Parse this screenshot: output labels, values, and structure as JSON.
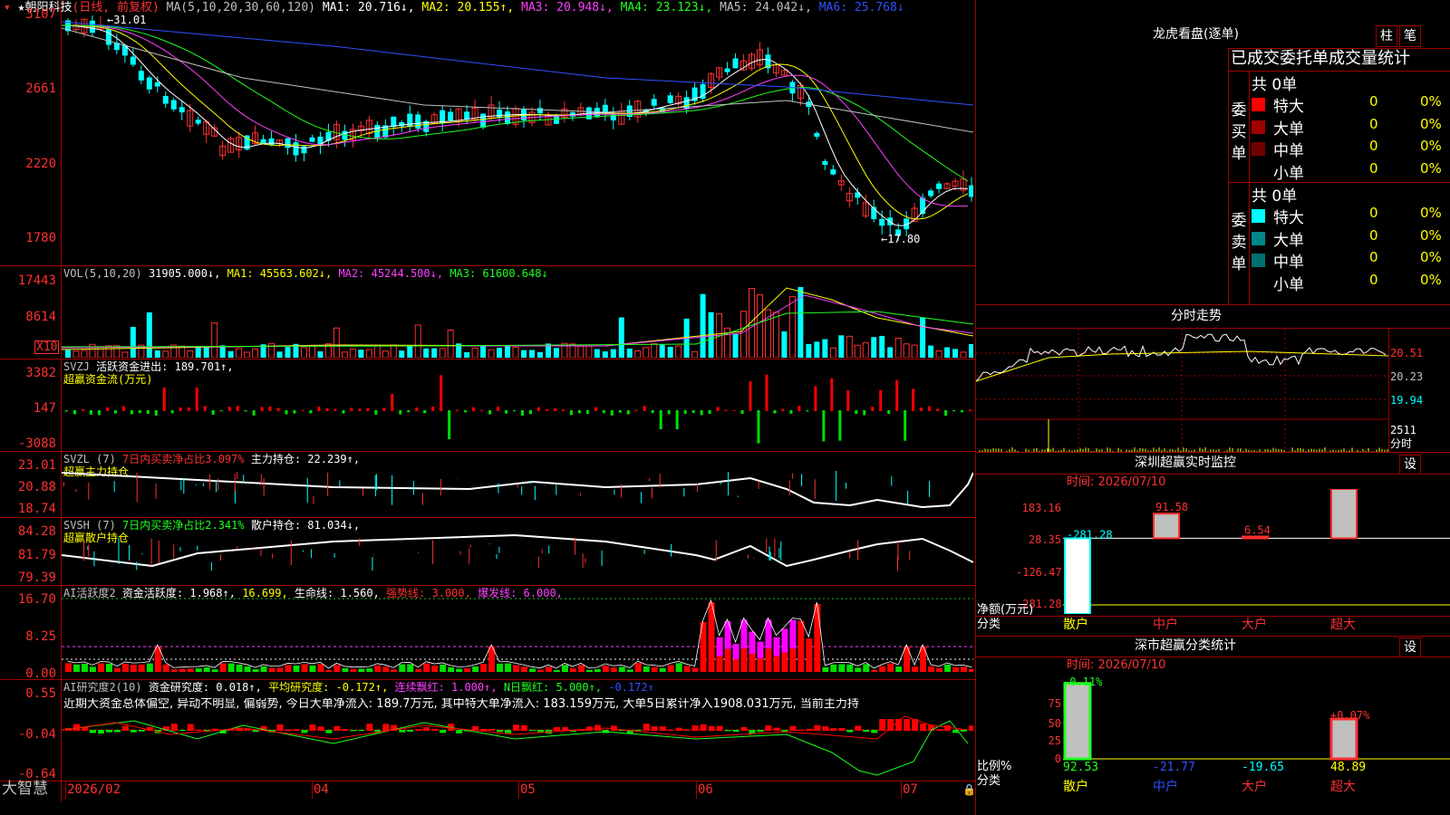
{
  "stock": {
    "name": "朝阳科技",
    "period": "(日线, 前复权)",
    "ma_label": "MA(5,10,20,30,60,120)",
    "ma1": "MA1: 20.716↓,",
    "ma2": "MA2: 20.155↑,",
    "ma3": "MA3: 20.948↓,",
    "ma4": "MA4: 23.123↓,",
    "ma5": "MA5: 24.042↓,",
    "ma6": "MA6: 25.768↓",
    "high_mark": "31.01",
    "low_mark": "17.80",
    "y_ticks": [
      "3107",
      "2661",
      "2220",
      "1780"
    ]
  },
  "vol": {
    "title": "VOL(5,10,20)",
    "value": "31905.000↓,",
    "ma1": "MA1: 45563.602↓,",
    "ma2": "MA2: 45244.500↓,",
    "ma3": "MA3: 61600.648↓",
    "y_ticks": [
      "17443",
      "8614"
    ],
    "unit": "X10"
  },
  "svzj": {
    "title": "SVZJ",
    "line": "活跃资金进出: 189.701↑,",
    "subtitle": "超赢资金流(万元)",
    "y_ticks": [
      "3382",
      "147",
      "-3088"
    ]
  },
  "svzl": {
    "title": "SVZL (7)",
    "ratio": "7日内买卖净占比3.097%",
    "hold": "主力持仓: 22.239↑,",
    "subtitle": "超赢主力持仓",
    "y_ticks": [
      "23.01",
      "20.88",
      "18.74"
    ]
  },
  "svsh": {
    "title": "SVSH (7)",
    "ratio": "7日内买卖净占比2.341%",
    "hold": "散户持仓: 81.034↓,",
    "subtitle": "超赢散户持仓",
    "y_ticks": [
      "84.28",
      "81.79",
      "79.39"
    ]
  },
  "ai1": {
    "title": "AI活跃度2",
    "a": "资金活跃度: 1.968↑,",
    "b": "16.699,",
    "c": "生命线: 1.560,",
    "d": "强势线: 3.000,",
    "e": "爆发线: 6.000,",
    "y_ticks": [
      "16.70",
      "8.25",
      "0.00"
    ]
  },
  "ai2": {
    "title": "AI研究度2(10)",
    "a": "资金研究度: 0.018↑,",
    "b": "平均研究度: -0.172↑,",
    "c": "连续飘红: 1.000↑,",
    "d": "N日飘红: 5.000↑,",
    "e": "-0.172↑",
    "summary": "近期大资金总体偏空, 异动不明显, 偏弱势, 今日大单净流入: 189.7万元, 其中特大单净流入: 183.159万元, 大单5日累计净入1908.031万元, 当前主力持",
    "y_ticks": [
      "0.55",
      "-0.04",
      "-0.64"
    ]
  },
  "bottom": {
    "brand": "大智慧",
    "dates": [
      "2026/02",
      "04",
      "05",
      "06",
      "07"
    ]
  },
  "right": {
    "dragon_title": "龙虎看盘(逐单)",
    "btn_zhu": "柱",
    "btn_bi": "笔",
    "stat_title": "已成交委托单成交量统计",
    "buy_label": "委买单",
    "sell_label": "委卖单",
    "buy_total": "共 0单",
    "sell_total": "共 0单",
    "buy_rows": [
      {
        "name": "特大",
        "n": "0",
        "p": "0%",
        "color": "#ff0000"
      },
      {
        "name": "大单",
        "n": "0",
        "p": "0%",
        "color": "#a00000"
      },
      {
        "name": "中单",
        "n": "0",
        "p": "0%",
        "color": "#700000"
      },
      {
        "name": "小单",
        "n": "0",
        "p": "0%",
        "color": "#000000"
      }
    ],
    "sell_rows": [
      {
        "name": "特大",
        "n": "0",
        "p": "0%",
        "color": "#00ffff"
      },
      {
        "name": "大单",
        "n": "0",
        "p": "0%",
        "color": "#008888"
      },
      {
        "name": "中单",
        "n": "0",
        "p": "0%",
        "color": "#007070"
      },
      {
        "name": "小单",
        "n": "0",
        "p": "0%",
        "color": "#000000"
      }
    ],
    "intraday_title": "分时走势",
    "intraday_ticks": [
      "20.51",
      "20.23",
      "19.94"
    ],
    "intraday_vol": "2511",
    "intraday_unit": "分时",
    "sz_title": "深圳超赢实时监控",
    "sz_btn": "设",
    "sz_time": "时间: 2026/07/10",
    "sz_ticks": [
      "183.16",
      "28.35",
      "-126.47",
      "-281.28"
    ],
    "sz_axis_label1": "净额(万元)",
    "sz_axis_label2": "分类",
    "sz_cats": [
      "散户",
      "中户",
      "大户",
      "超大"
    ],
    "sz_values": [
      "-281.28",
      "91.58",
      "6.54",
      "183.16"
    ],
    "stat_title2": "深市超赢分类统计",
    "stat_btn": "设",
    "stat_time": "时间: 2026/07/10",
    "stat_ticks": [
      "75",
      "50",
      "25",
      "0"
    ],
    "stat_axis1": "比例%",
    "stat_axis2": "分类",
    "stat_top_labels": [
      "-0.11%",
      "+0.07%"
    ],
    "stat_values": [
      "92.53",
      "-21.77",
      "-19.65",
      "48.89"
    ],
    "stat_cats": [
      "散户",
      "中户",
      "大户",
      "超大"
    ]
  },
  "chart_data": [
    {
      "type": "candlestick",
      "title": "朝阳科技 (日线, 前复权)",
      "ylim": [
        17.8,
        31.07
      ],
      "annotations": [
        "31.01",
        "17.80"
      ]
    },
    {
      "type": "bar",
      "title": "深圳超赢实时监控",
      "categories": [
        "散户",
        "中户",
        "大户",
        "超大"
      ],
      "values": [
        -281.28,
        91.58,
        6.54,
        183.16
      ],
      "ylabel": "净额(万元)",
      "ylim": [
        -281.28,
        183.16
      ]
    },
    {
      "type": "bar",
      "title": "深市超赢分类统计",
      "categories": [
        "散户",
        "中户",
        "大户",
        "超大"
      ],
      "values": [
        92.53,
        -21.77,
        -19.65,
        48.89
      ],
      "ylabel": "比例%",
      "ylim": [
        0,
        100
      ]
    }
  ]
}
